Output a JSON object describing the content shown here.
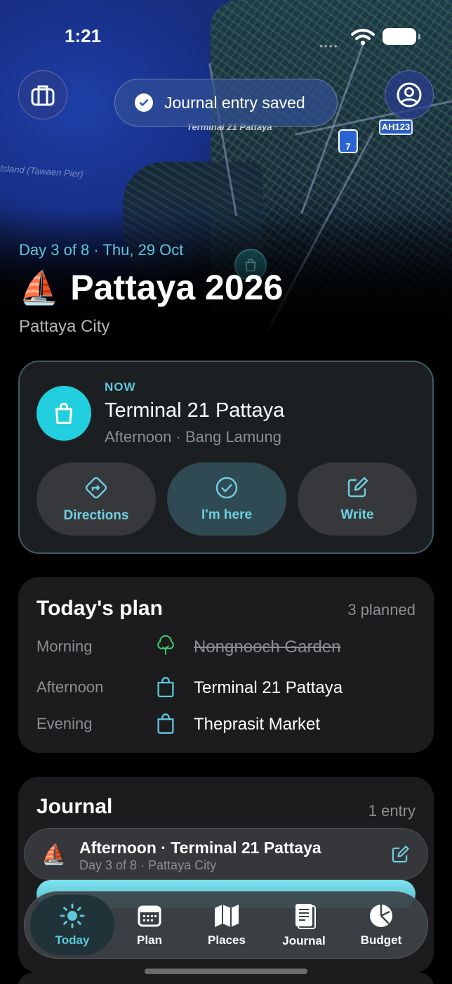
{
  "status_bar": {
    "time": "1:21"
  },
  "map": {
    "place_label": "Terminal 21 Pattaya",
    "pier_label": "Island (Tawaen Pier)",
    "route_shield": "7",
    "highway_shield": "AH123"
  },
  "toast": {
    "text": "Journal entry saved"
  },
  "header": {
    "day_line": "Day 3 of 8 · Thu, 29 Oct",
    "emoji": "⛵",
    "title": "Pattaya 2026",
    "city": "Pattaya City"
  },
  "now_card": {
    "tag": "NOW",
    "place": "Terminal 21 Pattaya",
    "detail": "Afternoon · Bang Lamung",
    "actions": [
      {
        "label": "Directions",
        "icon": "directions-icon"
      },
      {
        "label": "I'm here",
        "icon": "check-circle-icon"
      },
      {
        "label": "Write",
        "icon": "compose-icon"
      }
    ]
  },
  "plan": {
    "title": "Today's plan",
    "count": "3 planned",
    "rows": [
      {
        "time": "Morning",
        "place": "Nongnooch Garden",
        "icon": "tree-icon",
        "done": true
      },
      {
        "time": "Afternoon",
        "place": "Terminal 21 Pattaya",
        "icon": "shopping-bag-icon",
        "done": false
      },
      {
        "time": "Evening",
        "place": "Theprasit Market",
        "icon": "shopping-bag-icon",
        "done": false
      }
    ]
  },
  "journal": {
    "title": "Journal",
    "count": "1 entry"
  },
  "mini_player": {
    "emoji": "⛵",
    "title": "Afternoon · Terminal 21 Pattaya",
    "subtitle": "Day 3 of 8 · Pattaya City"
  },
  "tabs": [
    {
      "label": "Today",
      "icon": "sun-icon",
      "active": true
    },
    {
      "label": "Plan",
      "icon": "calendar-icon",
      "active": false
    },
    {
      "label": "Places",
      "icon": "map-icon",
      "active": false
    },
    {
      "label": "Journal",
      "icon": "journal-icon",
      "active": false
    },
    {
      "label": "Budget",
      "icon": "pie-chart-icon",
      "active": false
    }
  ],
  "colors": {
    "accent": "#5ec8dc",
    "now_icon_bg": "#22cfdf",
    "card_bg": "#1c1c1e",
    "tree_green": "#3fcf6a"
  }
}
